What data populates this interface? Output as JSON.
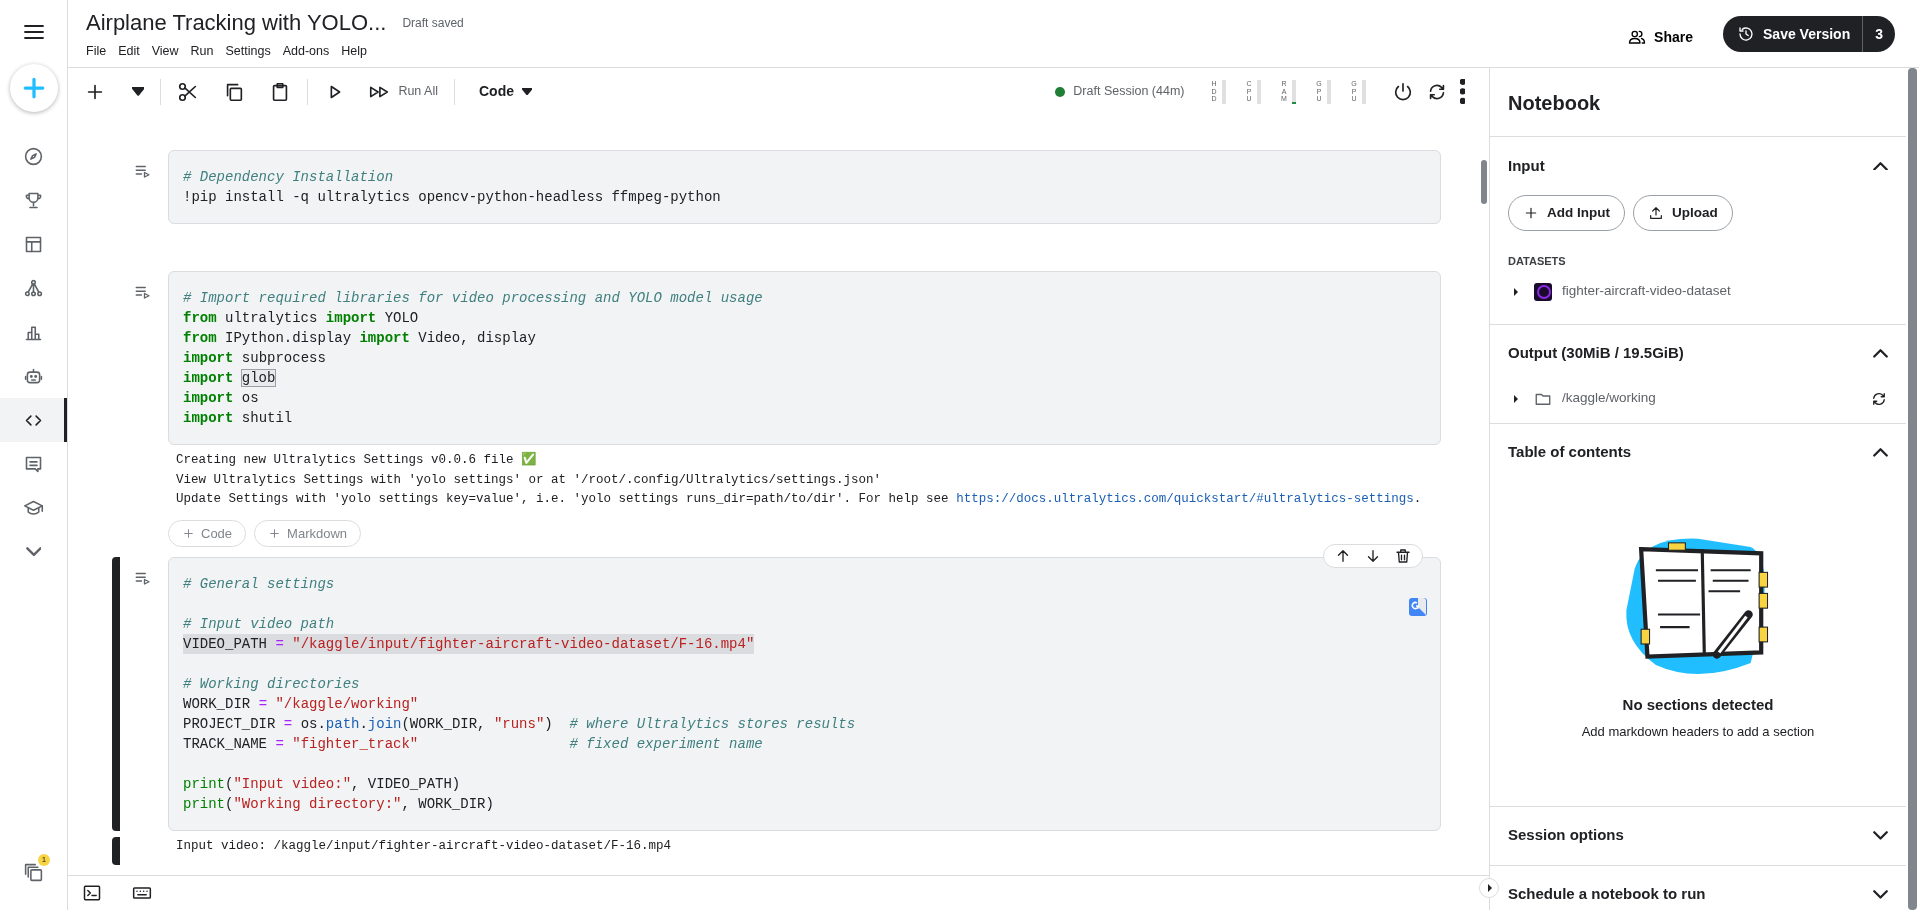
{
  "header": {
    "title": "Airplane Tracking with YOLO...",
    "save_status": "Draft saved",
    "menu": [
      "File",
      "Edit",
      "View",
      "Run",
      "Settings",
      "Add-ons",
      "Help"
    ],
    "share": "Share",
    "save_version": {
      "label": "Save Version",
      "count": "3"
    }
  },
  "sidebar": {
    "items": [
      {
        "selected": false
      },
      {
        "selected": false
      },
      {
        "selected": false
      },
      {
        "selected": false
      },
      {
        "selected": false
      },
      {
        "selected": false
      },
      {
        "selected": true
      },
      {
        "selected": false
      },
      {
        "selected": false
      },
      {
        "selected": false
      }
    ],
    "notification_count": "1"
  },
  "toolbar": {
    "run_all": "Run All",
    "cell_type": "Code",
    "session": {
      "label": "Draft Session (44m)",
      "active": true
    },
    "meters": [
      {
        "label": "HDD",
        "level": 0
      },
      {
        "label": "CPU",
        "level": 0
      },
      {
        "label": "RAM",
        "level": 0.05
      },
      {
        "label": "GPU",
        "level": 0
      },
      {
        "label": "GPU",
        "level": 0
      }
    ]
  },
  "cells": [
    {
      "selected": false,
      "lines": [
        {
          "tokens": [
            {
              "text": "# Dependency Installation",
              "kind": "comment"
            }
          ]
        },
        {
          "tokens": [
            {
              "text": "!pip install -q ultralytics opencv-python-headless ffmpeg-python",
              "kind": "plain"
            }
          ]
        }
      ]
    },
    {
      "selected": false,
      "lines": [
        {
          "tokens": [
            {
              "text": "# Import required libraries for video processing and YOLO model usage",
              "kind": "comment"
            }
          ]
        },
        {
          "tokens": [
            {
              "text": "from",
              "kind": "keyword"
            },
            {
              "text": " ultralytics ",
              "kind": "plain"
            },
            {
              "text": "import",
              "kind": "keyword"
            },
            {
              "text": " YOLO",
              "kind": "plain"
            }
          ]
        },
        {
          "tokens": [
            {
              "text": "from",
              "kind": "keyword"
            },
            {
              "text": " IPython.display ",
              "kind": "plain"
            },
            {
              "text": "import",
              "kind": "keyword"
            },
            {
              "text": " Video, display",
              "kind": "plain"
            }
          ]
        },
        {
          "tokens": [
            {
              "text": "import",
              "kind": "keyword"
            },
            {
              "text": " subprocess",
              "kind": "plain"
            }
          ]
        },
        {
          "tokens": [
            {
              "text": "import ",
              "kind": "keyword"
            },
            {
              "text": "glob",
              "kind": "match"
            }
          ]
        },
        {
          "tokens": [
            {
              "text": "import",
              "kind": "keyword"
            },
            {
              "text": " os",
              "kind": "plain"
            }
          ]
        },
        {
          "tokens": [
            {
              "text": "import",
              "kind": "keyword"
            },
            {
              "text": " shutil",
              "kind": "plain"
            }
          ]
        }
      ],
      "output": [
        {
          "text": "Creating new Ultralytics Settings v0.0.6 file ✅"
        },
        {
          "text": "View Ultralytics Settings with 'yolo settings' or at '/root/.config/Ultralytics/settings.json'"
        },
        {
          "text": "Update Settings with 'yolo settings key=value', i.e. 'yolo settings runs_dir=path/to/dir'. For help see ",
          "link": "https://docs.ultralytics.com/quickstart/#ultralytics-settings",
          "after": "."
        }
      ],
      "insert_buttons": [
        "Code",
        "Markdown"
      ]
    },
    {
      "selected": true,
      "lines": [
        {
          "tokens": [
            {
              "text": "# General settings",
              "kind": "comment"
            }
          ]
        },
        {
          "gap": true,
          "tokens": [
            {
              "text": "# Input video path",
              "kind": "comment"
            }
          ]
        },
        {
          "highlighted": true,
          "tokens": [
            {
              "text": "VIDEO_PATH ",
              "kind": "plain"
            },
            {
              "text": "=",
              "kind": "operator"
            },
            {
              "text": " \"/kaggle/input/fighter-aircraft-video-dataset/F-16.mp4\"",
              "kind": "string"
            }
          ]
        },
        {
          "gap": true,
          "tokens": [
            {
              "text": "# Working directories",
              "kind": "comment"
            }
          ]
        },
        {
          "tokens": [
            {
              "text": "WORK_DIR ",
              "kind": "plain"
            },
            {
              "text": "=",
              "kind": "operator"
            },
            {
              "text": " \"/kaggle/working\"",
              "kind": "string"
            }
          ]
        },
        {
          "tokens": [
            {
              "text": "PROJECT_DIR ",
              "kind": "plain"
            },
            {
              "text": "=",
              "kind": "operator"
            },
            {
              "text": " os.",
              "kind": "plain"
            },
            {
              "text": "path",
              "kind": "attribute"
            },
            {
              "text": ".",
              "kind": "plain"
            },
            {
              "text": "join",
              "kind": "attribute"
            },
            {
              "text": "(WORK_DIR, ",
              "kind": "plain"
            },
            {
              "text": "\"runs\"",
              "kind": "string"
            },
            {
              "text": ")",
              "kind": "plain"
            },
            {
              "text": "  # where Ultralytics stores results",
              "kind": "comment"
            }
          ]
        },
        {
          "tokens": [
            {
              "text": "TRACK_NAME ",
              "kind": "plain"
            },
            {
              "text": "=",
              "kind": "operator"
            },
            {
              "text": " \"fighter_track\"",
              "kind": "string"
            },
            {
              "text": "                  # fixed experiment name",
              "kind": "comment"
            }
          ]
        },
        {
          "gap": true,
          "tokens": [
            {
              "text": "print",
              "kind": "builtin"
            },
            {
              "text": "(",
              "kind": "plain"
            },
            {
              "text": "\"Input video:\"",
              "kind": "string"
            },
            {
              "text": ", VIDEO_PATH)",
              "kind": "plain"
            }
          ]
        },
        {
          "tokens": [
            {
              "text": "print",
              "kind": "builtin"
            },
            {
              "text": "(",
              "kind": "plain"
            },
            {
              "text": "\"Working directory:\"",
              "kind": "string"
            },
            {
              "text": ", WORK_DIR)",
              "kind": "plain"
            }
          ]
        }
      ],
      "output": [
        {
          "text": "Input video: /kaggle/input/fighter-aircraft-video-dataset/F-16.mp4"
        }
      ]
    }
  ],
  "panel": {
    "title": "Notebook",
    "sections": [
      {
        "kind": "input",
        "title": "Input",
        "expanded": true,
        "buttons": [
          "Add Input",
          "Upload"
        ],
        "group_label": "DATASETS",
        "items": [
          "fighter-aircraft-video-dataset"
        ]
      },
      {
        "kind": "output",
        "title": "Output (30MiB / 19.5GiB)",
        "expanded": true,
        "items": [
          "/kaggle/working"
        ]
      },
      {
        "kind": "toc",
        "title": "Table of contents",
        "expanded": true,
        "empty_title": "No sections detected",
        "empty_text": "Add markdown headers to add a section"
      },
      {
        "kind": "plain",
        "title": "Session options",
        "expanded": false
      },
      {
        "kind": "plain",
        "title": "Schedule a notebook to run",
        "expanded": false
      }
    ]
  }
}
